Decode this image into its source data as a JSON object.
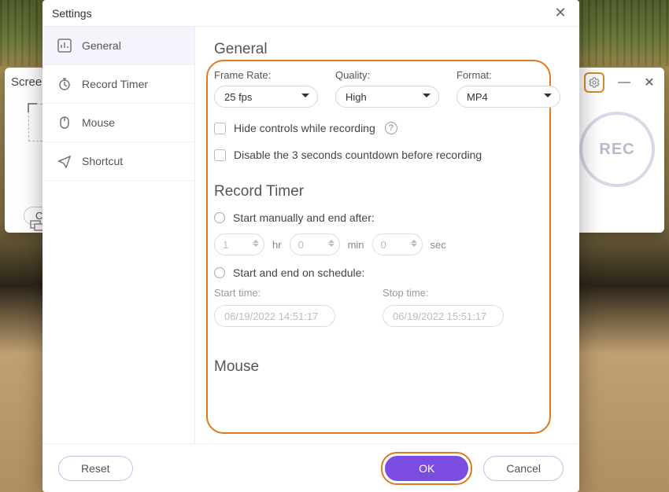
{
  "recorder": {
    "title_prefix": "Scree",
    "cu_label": "Cu",
    "rec_label": "REC"
  },
  "dialog": {
    "title": "Settings",
    "sidebar": {
      "items": [
        {
          "label": "General"
        },
        {
          "label": "Record Timer"
        },
        {
          "label": "Mouse"
        },
        {
          "label": "Shortcut"
        }
      ]
    },
    "general": {
      "heading": "General",
      "frame_rate": {
        "label": "Frame Rate:",
        "value": "25 fps"
      },
      "quality": {
        "label": "Quality:",
        "value": "High"
      },
      "format": {
        "label": "Format:",
        "value": "MP4"
      },
      "hide_controls_label": "Hide controls while recording",
      "disable_countdown_label": "Disable the 3 seconds countdown before recording"
    },
    "record_timer": {
      "heading": "Record Timer",
      "manual_label": "Start manually and end after:",
      "hr_value": "1",
      "hr_unit": "hr",
      "min_value": "0",
      "min_unit": "min",
      "sec_value": "0",
      "sec_unit": "sec",
      "schedule_label": "Start and end on schedule:",
      "start_label": "Start time:",
      "start_value": "06/19/2022 14:51:17",
      "stop_label": "Stop time:",
      "stop_value": "06/19/2022 15:51:17"
    },
    "mouse": {
      "heading": "Mouse"
    },
    "footer": {
      "reset": "Reset",
      "ok": "OK",
      "cancel": "Cancel"
    }
  }
}
